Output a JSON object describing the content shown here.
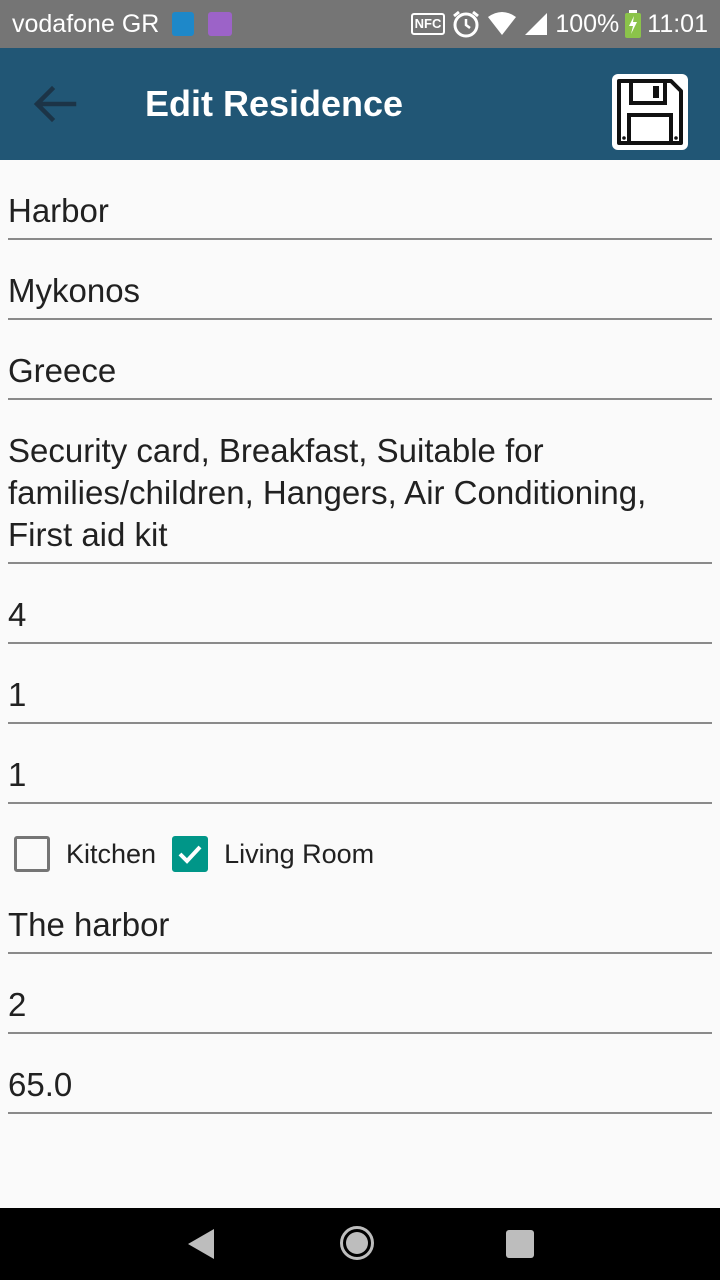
{
  "status_bar": {
    "carrier": "vodafone GR",
    "nfc": "NFC",
    "battery": "100%",
    "time": "11:01"
  },
  "app_bar": {
    "title": "Edit Residence"
  },
  "form": {
    "fields": [
      "Harbor",
      "Mykonos",
      "Greece",
      "Security card, Breakfast, Suitable for families/children, Hangers, Air Conditioning, First aid kit",
      "4",
      "1",
      "1"
    ],
    "checkboxes": [
      {
        "label": "Kitchen",
        "checked": false
      },
      {
        "label": "Living Room",
        "checked": true
      }
    ],
    "fields_after": [
      "The harbor",
      "2",
      "65.0"
    ]
  },
  "colors": {
    "app_bar": "#215675",
    "status_bar": "#757575",
    "checkbox_checked": "#009688"
  }
}
